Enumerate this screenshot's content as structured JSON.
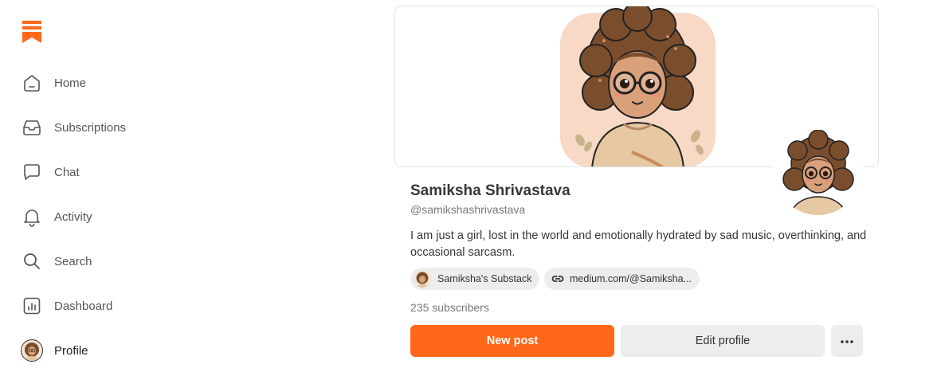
{
  "sidebar": {
    "logo_icon": "substack-logo-icon",
    "accent_color": "#FF6719",
    "items": [
      {
        "label": "Home",
        "icon": "home-icon"
      },
      {
        "label": "Subscriptions",
        "icon": "inbox-icon"
      },
      {
        "label": "Chat",
        "icon": "chat-bubble-icon"
      },
      {
        "label": "Activity",
        "icon": "bell-icon"
      },
      {
        "label": "Search",
        "icon": "search-icon"
      },
      {
        "label": "Dashboard",
        "icon": "dashboard-icon"
      },
      {
        "label": "Profile",
        "icon": "avatar-icon"
      }
    ]
  },
  "profile": {
    "name": "Samiksha Shrivastava",
    "handle": "@samikshashrivastava",
    "bio": "I am just a girl, lost in the world and emotionally hydrated by sad music, overthinking, and occasional sarcasm.",
    "links": [
      {
        "label": "Samiksha's Substack",
        "icon": "avatar-icon"
      },
      {
        "label": "medium.com/@Samiksha...",
        "icon": "link-icon"
      }
    ],
    "subscribers": "235 subscribers",
    "new_post_label": "New post",
    "edit_profile_label": "Edit profile",
    "more_label": "···"
  }
}
